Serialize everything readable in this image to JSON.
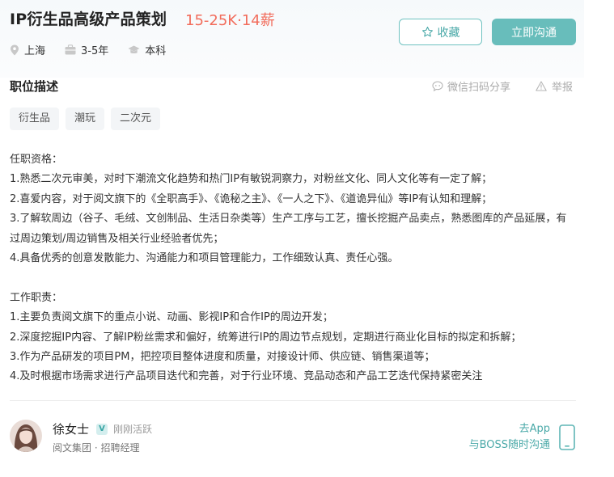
{
  "job": {
    "title": "IP衍生品高级产品策划",
    "salary": "15-25K·14薪",
    "location": "上海",
    "experience": "3-5年",
    "education": "本科"
  },
  "actions": {
    "favorite_label": "收藏",
    "chat_label": "立即沟通"
  },
  "section": {
    "title": "职位描述",
    "share_label": "微信扫码分享",
    "report_label": "举报"
  },
  "tags": [
    "衍生品",
    "潮玩",
    "二次元"
  ],
  "description": {
    "qual_heading": "任职资格：",
    "qualifications": [
      "1.熟悉二次元审美，对时下潮流文化趋势和热门IP有敏锐洞察力，对粉丝文化、同人文化等有一定了解；",
      "2.喜爱内容，对于阅文旗下的《全职高手》、《诡秘之主》、《一人之下》、《道诡异仙》等IP有认知和理解；",
      "3.了解软周边（谷子、毛绒、文创制品、生活日杂类等）生产工序与工艺，擅长挖掘产品卖点，熟悉图库的产品延展，有过周边策划/周边销售及相关行业经验者优先；",
      "4.具备优秀的创意发散能力、沟通能力和项目管理能力，工作细致认真、责任心强。"
    ],
    "duty_heading": "工作职责：",
    "duties": [
      "1.主要负责阅文旗下的重点小说、动画、影视IP和合作IP的周边开发；",
      "2.深度挖掘IP内容、了解IP粉丝需求和偏好，统筹进行IP的周边节点规划，定期进行商业化目标的拟定和拆解；",
      "3.作为产品研发的项目PM，把控项目整体进度和质量，对接设计师、供应链、销售渠道等；",
      "4.及时根据市场需求进行产品项目迭代和完善，对于行业环境、竞品动态和产品工艺迭代保持紧密关注"
    ]
  },
  "recruiter": {
    "name": "徐女士",
    "verified_mark": "V",
    "status": "刚刚活跃",
    "company_role": "阅文集团 · 招聘经理"
  },
  "app_promo": {
    "line1": "去App",
    "line2": "与BOSS随时沟通"
  },
  "colors": {
    "accent": "#68bdbb",
    "salary": "#f26d5c"
  }
}
